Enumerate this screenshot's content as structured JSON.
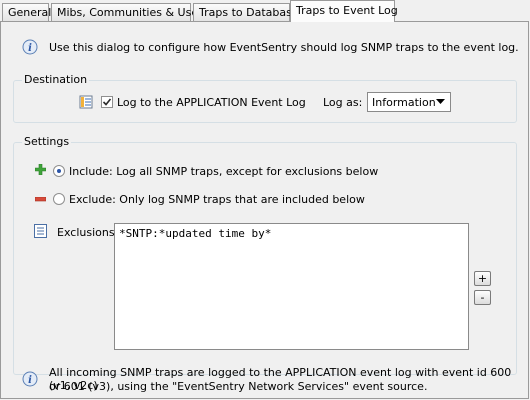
{
  "tabs": [
    {
      "label": "General"
    },
    {
      "label": "Mibs, Communities & Users"
    },
    {
      "label": "Traps to Database"
    },
    {
      "label": "Traps to Event Log"
    }
  ],
  "active_tab": "Traps to Event Log",
  "intro_text": "Use this dialog to configure how EventSentry should log SNMP traps to the event log.",
  "destination": {
    "legend": "Destination",
    "log_checkbox_label": "Log to the APPLICATION Event Log",
    "log_checked": true,
    "log_as_label": "Log as:",
    "log_as_value": "Information"
  },
  "settings": {
    "legend": "Settings",
    "include_label": "Include: Log all SNMP traps, except for exclusions below",
    "include_selected": true,
    "exclude_label": "Exclude: Only log SNMP traps that are included below",
    "exclude_selected": false,
    "exclusions_label": "Exclusions:",
    "exclusions_value": "*SNTP:*updated time by*",
    "add_button": "+",
    "remove_button": "-"
  },
  "footer_info": {
    "line1": "All incoming SNMP traps are logged to the APPLICATION event log with event id 600 (v1, v2c)",
    "line2": "or 601 (v3), using the \"EventSentry Network Services\" event source."
  },
  "icons": [
    "info-icon",
    "event-log-icon",
    "plus-icon",
    "minus-icon",
    "list-icon",
    "info-icon"
  ]
}
